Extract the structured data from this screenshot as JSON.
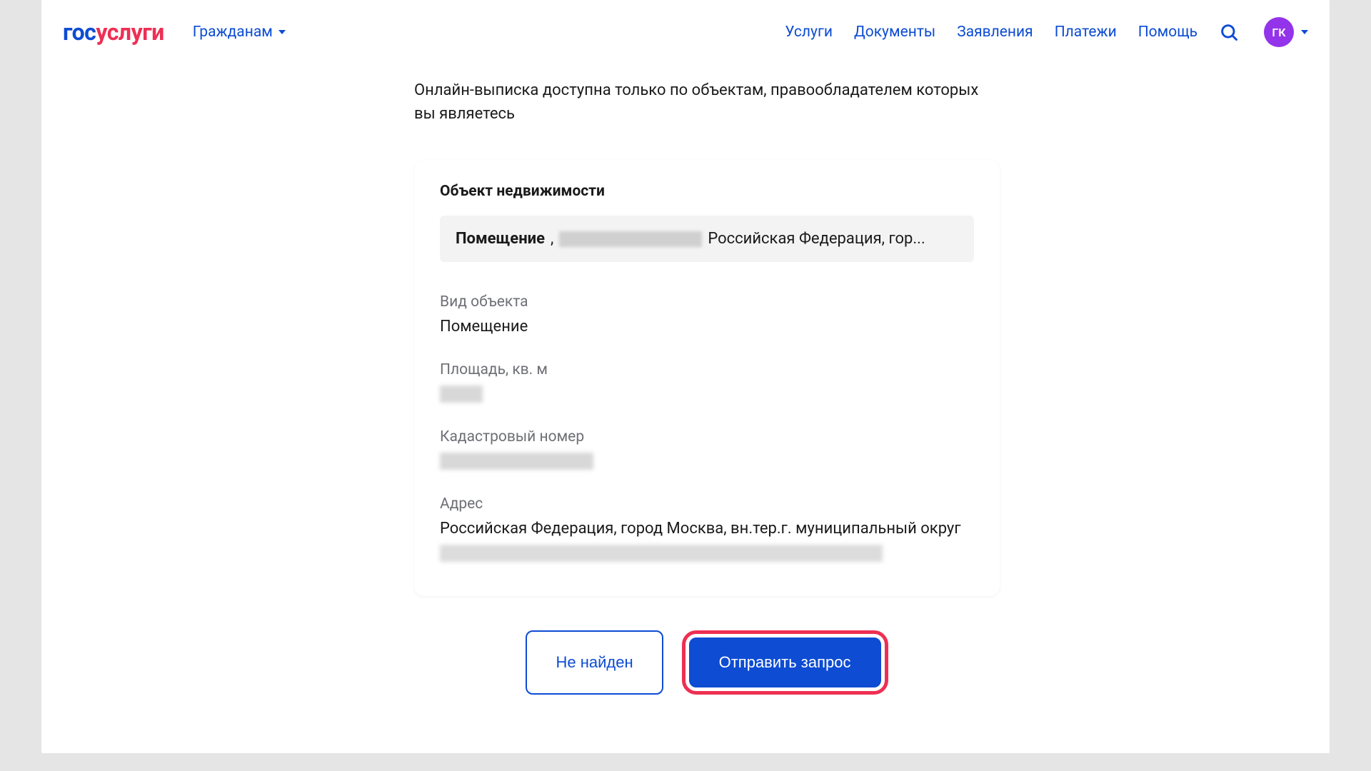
{
  "header": {
    "logo_gos": "гос",
    "logo_uslugi": "услуги",
    "citizens_label": "Гражданам",
    "nav": {
      "services": "Услуги",
      "documents": "Документы",
      "applications": "Заявления",
      "payments": "Платежи",
      "help": "Помощь"
    },
    "avatar_initials": "ГК"
  },
  "intro_text": "Онлайн-выписка доступна только по объектам, правообладателем которых вы являетесь",
  "card": {
    "title": "Объект недвижимости",
    "object_type": "Помещение",
    "object_comma": ", ",
    "object_suffix": "Российская Федерация, гор...",
    "fields": {
      "type_label": "Вид объекта",
      "type_value": "Помещение",
      "area_label": "Площадь, кв. м",
      "cadastral_label": "Кадастровый номер",
      "address_label": "Адрес",
      "address_line1": "Российская Федерация, город Москва, вн.тер.г. муниципальный округ"
    }
  },
  "buttons": {
    "not_found": "Не найден",
    "submit": "Отправить запрос"
  }
}
